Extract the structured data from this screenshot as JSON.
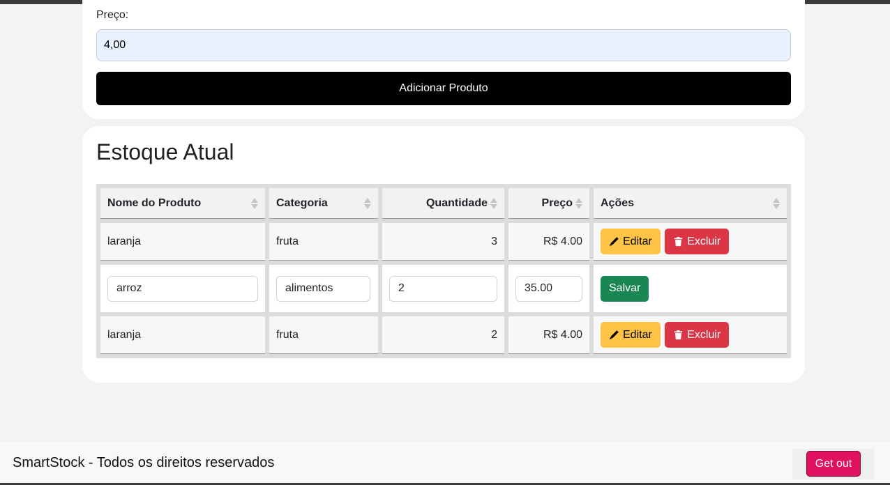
{
  "form": {
    "price_label": "Preço:",
    "price_value": "4,00",
    "add_button": "Adicionar Produto"
  },
  "stock": {
    "title": "Estoque Atual",
    "columns": [
      "Nome do Produto",
      "Categoria",
      "Quantidade",
      "Preço",
      "Ações"
    ],
    "rows": [
      {
        "name": "laranja",
        "category": "fruta",
        "quantity": "3",
        "price": "R$ 4.00"
      },
      {
        "name": "arroz",
        "category": "alimentos",
        "quantity": "2",
        "price": "35.00"
      },
      {
        "name": "laranja",
        "category": "fruta",
        "quantity": "2",
        "price": "R$ 4.00"
      }
    ],
    "edit_label": "Editar",
    "delete_label": "Excluir",
    "save_label": "Salvar"
  },
  "footer": {
    "text": "SmartStock - Todos os direitos reservados",
    "logout_label": "Get out"
  },
  "colors": {
    "edit": "#ffc446",
    "delete": "#dc3545",
    "save": "#198754",
    "logout": "#e0115f"
  },
  "icons": {
    "edit": "pencil-icon",
    "delete": "trash-icon",
    "sort": "sort-icon"
  }
}
